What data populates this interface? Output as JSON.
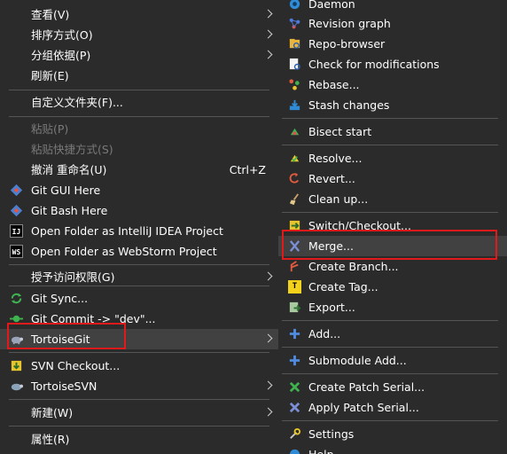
{
  "main_menu": {
    "view": "查看(V)",
    "sort_by": "排序方式(O)",
    "group_by": "分组依据(P)",
    "refresh": "刷新(E)",
    "customize_folder": "自定义文件夹(F)...",
    "paste": "粘贴(P)",
    "paste_shortcut": "粘贴快捷方式(S)",
    "undo_rename": "撤消 重命名(U)",
    "undo_shortcut": "Ctrl+Z",
    "git_gui": "Git GUI Here",
    "git_bash": "Git Bash Here",
    "open_intellij": "Open Folder as IntelliJ IDEA Project",
    "open_webstorm": "Open Folder as WebStorm Project",
    "give_access": "授予访问权限(G)",
    "git_sync": "Git Sync...",
    "git_commit": "Git Commit -> \"dev\"...",
    "tortoisegit": "TortoiseGit",
    "svn_checkout": "SVN Checkout...",
    "tortoisesvn": "TortoiseSVN",
    "new": "新建(W)",
    "properties": "属性(R)"
  },
  "sub_menu": {
    "daemon": "Daemon",
    "revision_graph": "Revision graph",
    "repo_browser": "Repo-browser",
    "check_modifications": "Check for modifications",
    "rebase": "Rebase...",
    "stash_changes": "Stash changes",
    "bisect_start": "Bisect start",
    "resolve": "Resolve...",
    "revert": "Revert...",
    "clean_up": "Clean up...",
    "switch_checkout": "Switch/Checkout...",
    "merge": "Merge...",
    "create_branch": "Create Branch...",
    "create_tag": "Create Tag...",
    "export": "Export...",
    "add": "Add...",
    "submodule_add": "Submodule Add...",
    "create_patch_serial": "Create Patch Serial...",
    "apply_patch_serial": "Apply Patch Serial...",
    "settings": "Settings",
    "help": "Help"
  },
  "icons": {
    "ij_text": "IJ",
    "ws_text": "WS",
    "tag_text": "T"
  },
  "colors": {
    "menu_bg": "#2b2b2b",
    "hover_bg": "#414141",
    "highlight_border": "#e01a1a",
    "disabled_text": "#7a7a7a"
  }
}
